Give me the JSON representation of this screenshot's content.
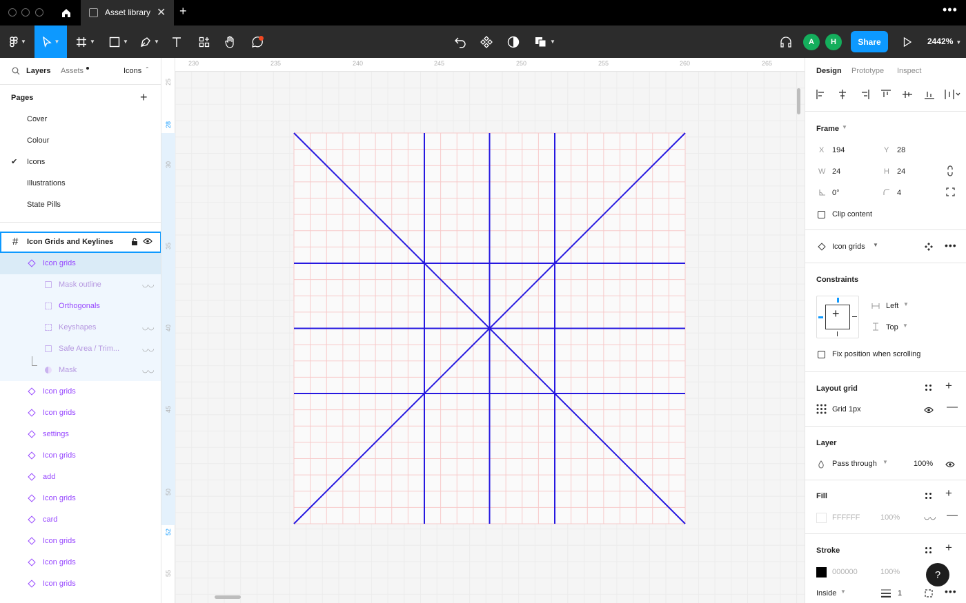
{
  "titlebar": {
    "tab_label": "Asset library",
    "close_glyph": "✕",
    "new_tab_glyph": "+",
    "more_glyph": "•••"
  },
  "toolbar": {
    "share_label": "Share",
    "zoom_label": "2442%",
    "avatars": [
      "A",
      "H"
    ],
    "avatar_colors": [
      "#14ae5c",
      "#14ae5c"
    ],
    "accent": "#0d99ff"
  },
  "left_panel": {
    "tabs": [
      "Layers",
      "Assets",
      "Icons"
    ],
    "pages_header": "Pages",
    "pages": [
      "Cover",
      "Colour",
      "Icons",
      "Illustrations",
      "State Pills"
    ],
    "current_page_index": 2,
    "frame_name": "Icon Grids and Keylines",
    "selected_component": "Icon grids",
    "children": [
      "Mask outline",
      "Orthogonals",
      "Keyshapes",
      "Safe Area / Trim...",
      "Mask"
    ],
    "siblings": [
      "Icon grids",
      "Icon grids",
      "settings",
      "Icon grids",
      "add",
      "Icon grids",
      "card",
      "Icon grids",
      "Icon grids",
      "Icon grids"
    ]
  },
  "canvas": {
    "h_ruler": [
      "230",
      "235",
      "240",
      "245",
      "250",
      "255",
      "260",
      "265"
    ],
    "v_ruler": [
      "25",
      "28",
      "30",
      "35",
      "40",
      "45",
      "50",
      "52",
      "55"
    ],
    "v_ruler_selected": [
      "28",
      "52"
    ],
    "keyline_color": "#2618e0",
    "pixel_grid_color": "#f7c9c9"
  },
  "right_panel": {
    "tabs": [
      "Design",
      "Prototype",
      "Inspect"
    ],
    "frame_section": "Frame",
    "x_label": "X",
    "x": "194",
    "y_label": "Y",
    "y": "28",
    "w_label": "W",
    "w": "24",
    "h_label": "H",
    "h": "24",
    "rotation": "0°",
    "radius": "4",
    "clip_content": "Clip content",
    "component_name": "Icon grids",
    "constraints_title": "Constraints",
    "constraint_h": "Left",
    "constraint_v": "Top",
    "fix_position": "Fix position when scrolling",
    "layout_grid_title": "Layout grid",
    "grid_name": "Grid 1px",
    "layer_title": "Layer",
    "blend_mode": "Pass through",
    "layer_opacity": "100%",
    "fill_title": "Fill",
    "fill_hex": "FFFFFF",
    "fill_opacity": "100%",
    "stroke_title": "Stroke",
    "stroke_hex": "000000",
    "stroke_opacity": "100%",
    "stroke_position": "Inside",
    "stroke_weight": "1",
    "help": "?"
  }
}
